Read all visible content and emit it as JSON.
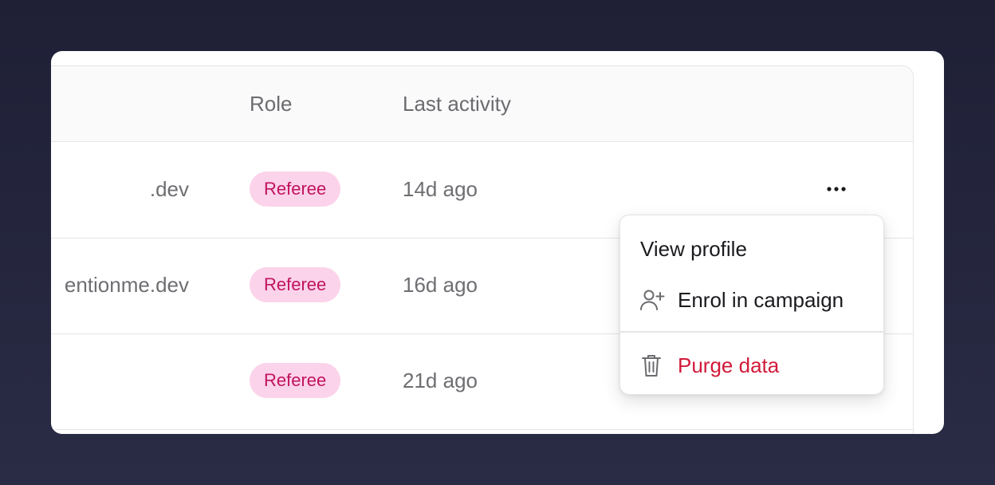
{
  "table": {
    "columns": {
      "role": "Role",
      "last_activity": "Last activity"
    },
    "rows": [
      {
        "email": ".dev",
        "role": "Referee",
        "last_activity": "14d ago"
      },
      {
        "email": "entionme.dev",
        "role": "Referee",
        "last_activity": "16d ago"
      },
      {
        "email": "",
        "role": "Referee",
        "last_activity": "21d ago"
      }
    ]
  },
  "row_menu": {
    "view_profile": "View profile",
    "enrol": "Enrol in campaign",
    "purge": "Purge data"
  },
  "colors": {
    "badge_bg": "#fbd3ea",
    "badge_text": "#c0135f",
    "danger": "#d11a3a",
    "backdrop": "#23243b"
  },
  "icons": {
    "more": "more-horizontal-icon",
    "enrol": "user-plus-icon",
    "purge": "trash-icon"
  }
}
